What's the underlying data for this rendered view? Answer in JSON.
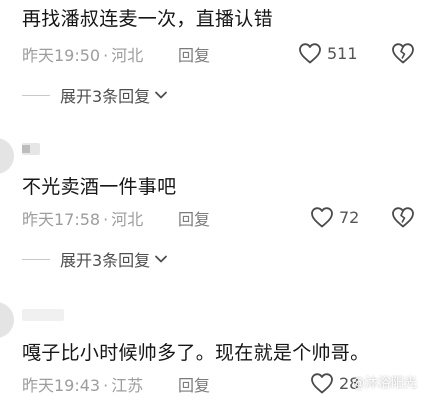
{
  "comments": [
    {
      "text": "再找潘叔连麦一次，直播认错",
      "time": "昨天19:50",
      "location": "河北",
      "reply_label": "回复",
      "likes": "511",
      "expand_label": "展开3条回复"
    },
    {
      "text": "不光卖酒一件事吧",
      "time": "昨天17:58",
      "location": "河北",
      "reply_label": "回复",
      "likes": "72",
      "expand_label": "展开3条回复"
    },
    {
      "text": "嘎子比小时候帅多了。现在就是个帅哥。",
      "time": "昨天19:43",
      "location": "江苏",
      "reply_label": "回复",
      "likes": "28"
    }
  ],
  "separator": "·",
  "watermark": "@沐浴阳光",
  "icons": {
    "like": "heart-outline-icon",
    "dislike": "broken-heart-icon",
    "expand": "chevron-down-icon"
  },
  "colors": {
    "text": "#161616",
    "meta": "#9d9d9d",
    "icon": "#4a4a4a"
  }
}
